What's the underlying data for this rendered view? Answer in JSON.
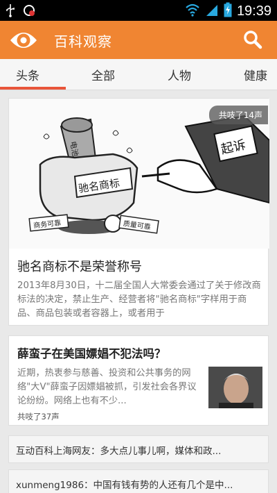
{
  "status_bar": {
    "time": "19:39"
  },
  "app_bar": {
    "title": "百科观察"
  },
  "tabs": [
    "头条",
    "全部",
    "人物",
    "健康"
  ],
  "hero": {
    "badge": "共吱了14声",
    "title": "驰名商标不是荣誉称号",
    "summary": "2013年8月30日，十二届全国人大常委会通过了关于修改商标法的决定，禁止生产、经营者将\"驰名商标\"字样用于商品、商品包装或者容器上，或者用于",
    "illustration_text": [
      "电池",
      "驰名商标",
      "商务可靠",
      "质量可靠",
      "起诉"
    ]
  },
  "article": {
    "title": "薛蛮子在美国嫖娼不犯法吗？",
    "summary": "近期，热衷参与慈善、投资和公共事务的网络\"大V\"薛蛮子因嫖娼被抓，引发社会各界议论纷纷。网络上也有不少...",
    "meta": "共吱了37声"
  },
  "comments": [
    "互动百科上海网友：多大点儿事儿啊，媒体和政...",
    "xunmeng1986：中国有钱有势的人还有几个是中..."
  ],
  "colors": {
    "accent": "#f08532",
    "tab_indicator": "#e8553a"
  }
}
